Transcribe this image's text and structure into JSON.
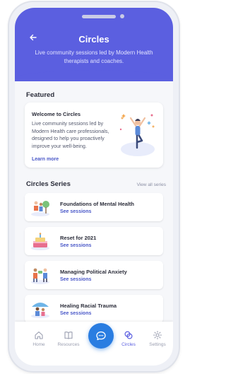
{
  "header": {
    "title": "Circles",
    "subtitle": "Live community sessions led by Modern Health therapists and coaches."
  },
  "featured": {
    "section_title": "Featured",
    "card": {
      "title": "Welcome to Circles",
      "description": "Live community sessions led by Modern Health care professionals, designed to help you proactively improve your well-being.",
      "link_label": "Learn more"
    }
  },
  "series": {
    "section_title": "Circles Series",
    "view_all_label": "View all series",
    "items": [
      {
        "name": "Foundations of Mental Health",
        "link_label": "See sessions",
        "icon": "people-outdoors-icon"
      },
      {
        "name": "Reset for 2021",
        "link_label": "See sessions",
        "icon": "calendar-cake-icon"
      },
      {
        "name": "Managing Political Anxiety",
        "link_label": "See sessions",
        "icon": "people-talking-icon"
      },
      {
        "name": "Healing Racial Trauma",
        "link_label": "See sessions",
        "icon": "people-umbrella-icon"
      }
    ]
  },
  "tabbar": {
    "home": "Home",
    "resources": "Resources",
    "circles": "Circles",
    "settings": "Settings"
  },
  "colors": {
    "brand": "#5b5fe0",
    "link": "#4a58c8",
    "fab": "#2a7de1"
  }
}
